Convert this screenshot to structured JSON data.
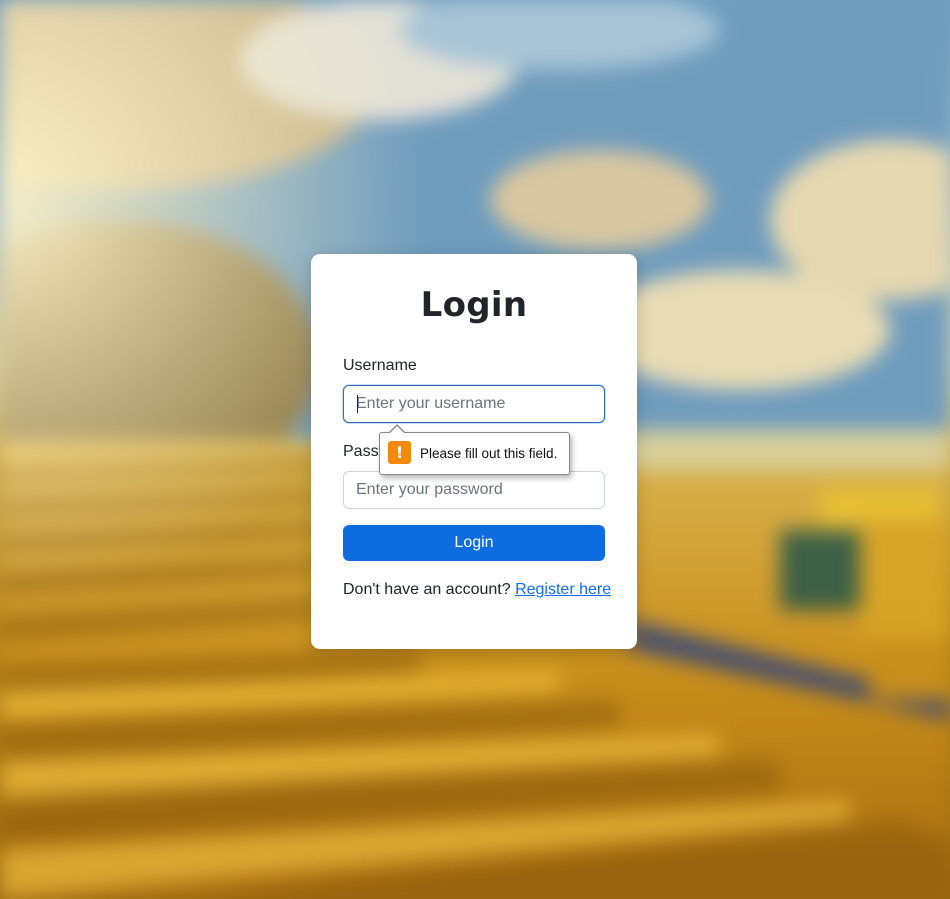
{
  "login_form": {
    "title": "Login",
    "username_label": "Username",
    "username_placeholder": "Enter your username",
    "username_value": "",
    "password_label": "Passw",
    "password_placeholder": "Enter your password",
    "password_value": "",
    "submit_label": "Login",
    "register_prompt": "Don't have an account?",
    "register_link": "Register here"
  },
  "validation_tooltip": {
    "icon": "warning-icon",
    "icon_glyph": "!",
    "message": "Please fill out this field."
  },
  "colors": {
    "primary_button": "#0d6de0",
    "link": "#0d6efd",
    "focus_border": "#2d6ec9",
    "warning": "#f48a0b"
  }
}
